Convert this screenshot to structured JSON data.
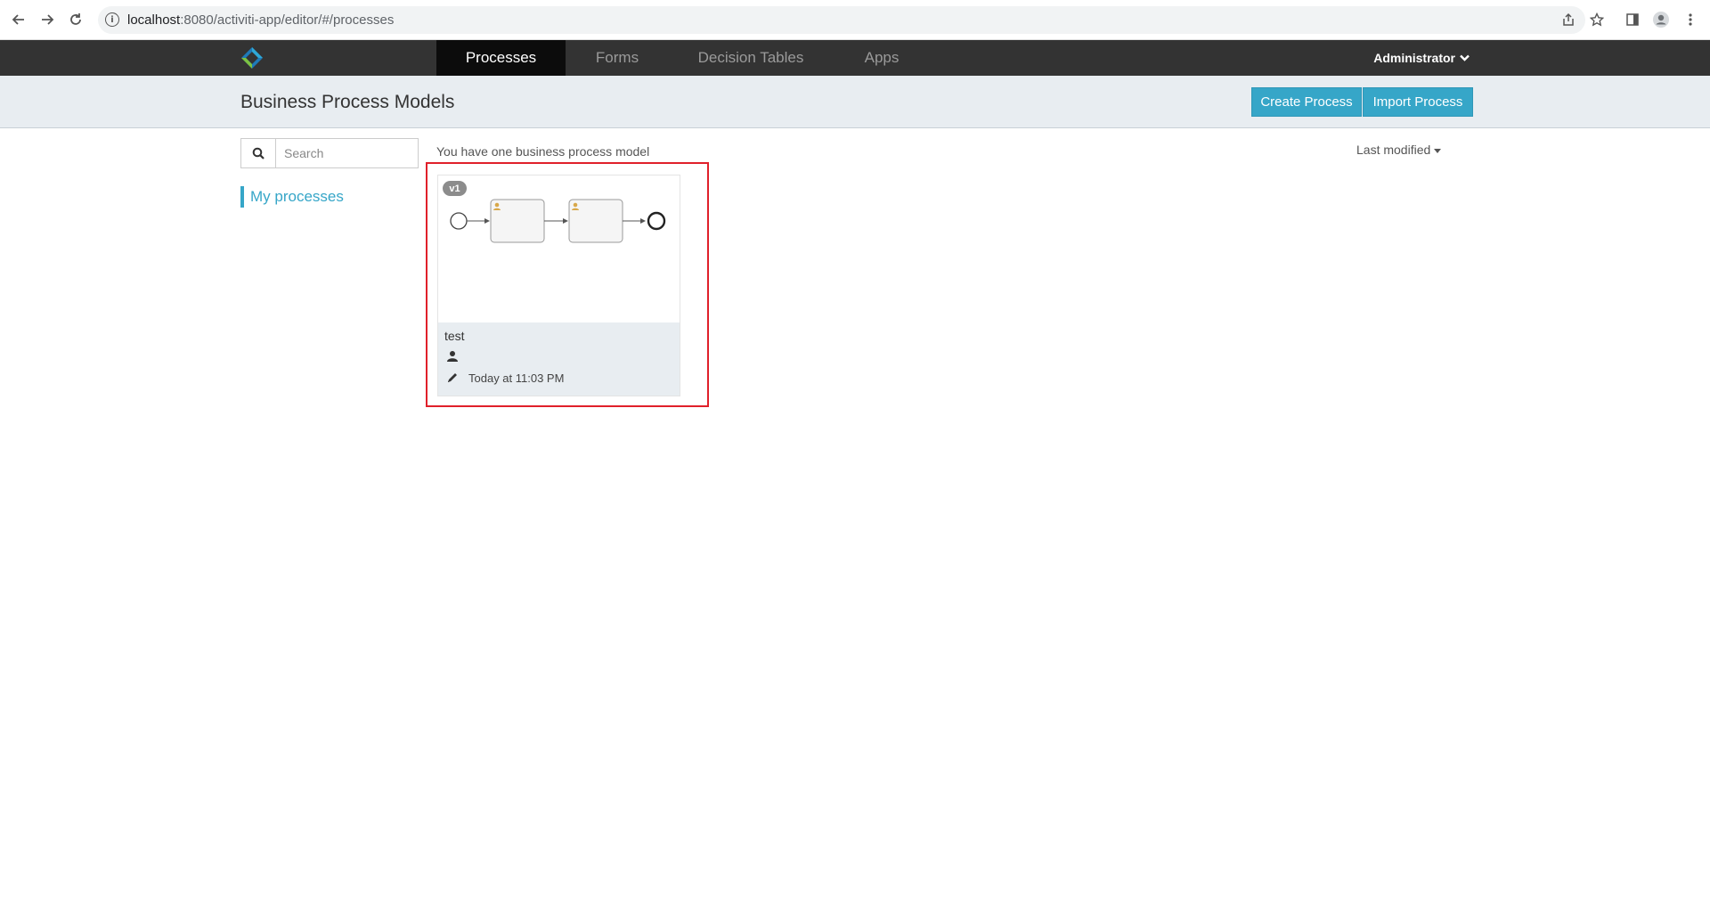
{
  "browser": {
    "url_host": "localhost",
    "url_path": ":8080/activiti-app/editor/#/processes",
    "info_glyph": "i"
  },
  "navbar": {
    "tabs": [
      {
        "label": "Processes",
        "active": true
      },
      {
        "label": "Forms",
        "active": false
      },
      {
        "label": "Decision Tables",
        "active": false
      },
      {
        "label": "Apps",
        "active": false
      }
    ],
    "user_label": "Administrator"
  },
  "subheader": {
    "title": "Business Process Models",
    "create_label": "Create Process",
    "import_label": "Import Process"
  },
  "sidebar": {
    "search_placeholder": "Search",
    "filters": [
      {
        "label": "My processes",
        "active": true
      }
    ]
  },
  "main": {
    "summary": "You have one business process model",
    "sort_label": "Last modified",
    "models": [
      {
        "version": "v1",
        "name": "test",
        "modified": "Today at 11:03 PM"
      }
    ]
  },
  "colors": {
    "accent": "#36a6c8",
    "navbar": "#333333",
    "highlight": "#e0202a"
  }
}
